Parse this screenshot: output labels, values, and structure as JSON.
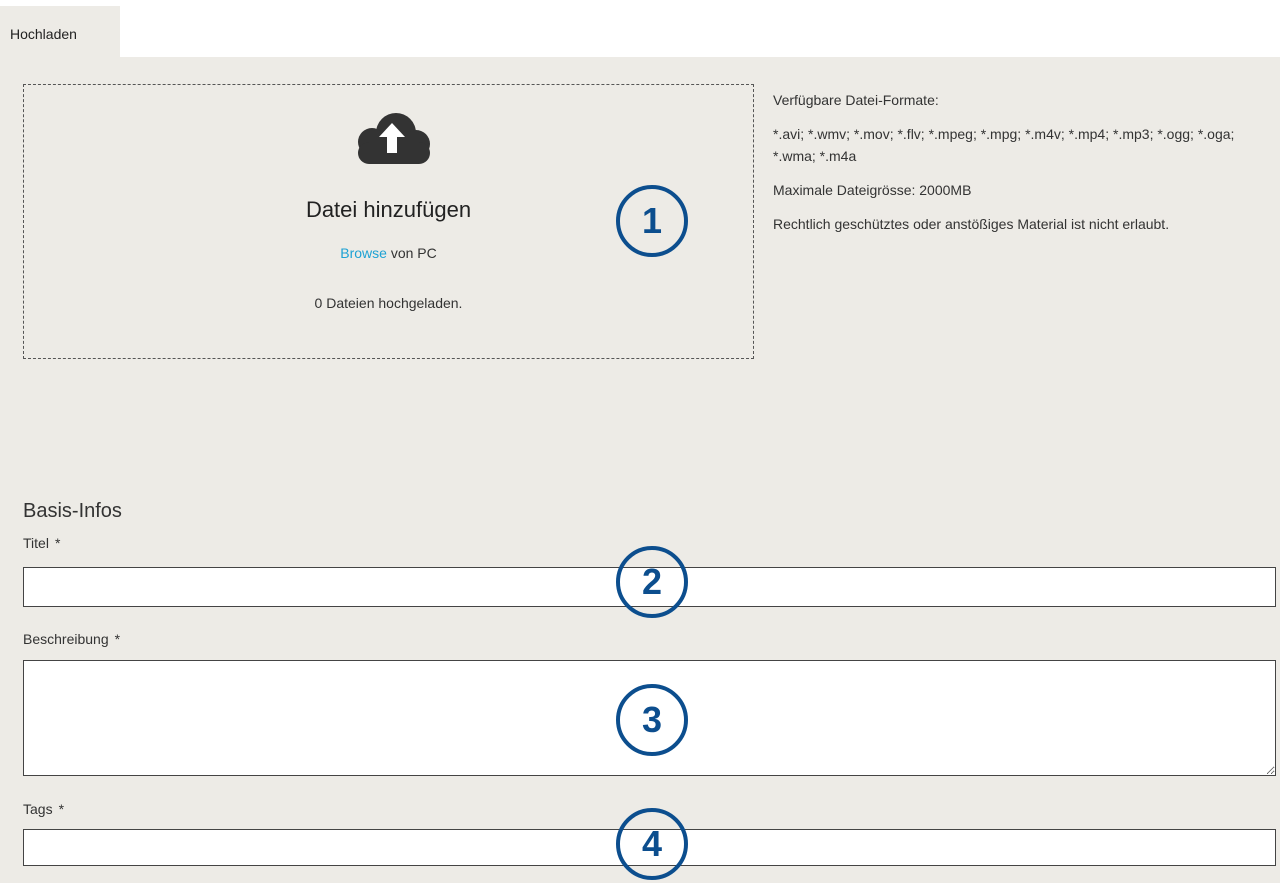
{
  "tabs": {
    "upload_label": "Hochladen"
  },
  "dropzone": {
    "title": "Datei hinzufügen",
    "browse_link": "Browse",
    "browse_suffix": " von PC",
    "count_text": "0 Dateien hochgeladen.",
    "icon": "cloud-upload-icon"
  },
  "info": {
    "formats_heading": "Verfügbare Datei-Formate:",
    "formats_list": "*.avi; *.wmv; *.mov; *.flv; *.mpeg; *.mpg; *.m4v; *.mp4; *.mp3; *.ogg; *.oga; *.wma; *.m4a",
    "max_size": "Maximale Dateigrösse: 2000MB",
    "legal_notice": "Rechtlich geschütztes oder anstößiges Material ist nicht erlaubt."
  },
  "basis": {
    "heading": "Basis-Infos",
    "title_label": "Titel",
    "description_label": "Beschreibung",
    "tags_label": "Tags",
    "required_marker": "*",
    "title_value": "",
    "description_value": "",
    "tags_value": ""
  },
  "badges": [
    "1",
    "2",
    "3",
    "4"
  ],
  "colors": {
    "badge": "#0c4e8e",
    "link": "#1ea2d4",
    "panel": "#edebe6"
  }
}
